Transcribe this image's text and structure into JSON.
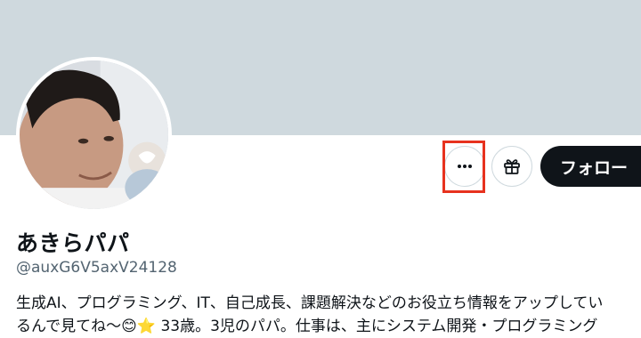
{
  "profile": {
    "display_name": "あきらパパ",
    "handle": "@auxG6V5axV24128",
    "bio_line1": "生成AI、プログラミング、IT、自己成長、課題解決などのお役立ち情報をアップしてい",
    "bio_line2": "るんで見てね〜😊⭐ 33歳。3児のパパ。仕事は、主にシステム開発・プログラミング"
  },
  "actions": {
    "more_label": "•••",
    "follow_label": "フォロー"
  },
  "icons": {
    "more": "more-horizontal-icon",
    "gift": "gift-icon"
  },
  "colors": {
    "banner": "#cfd9de",
    "follow_bg": "#0f1419",
    "highlight": "#e7321e",
    "secondary_text": "#536471"
  }
}
